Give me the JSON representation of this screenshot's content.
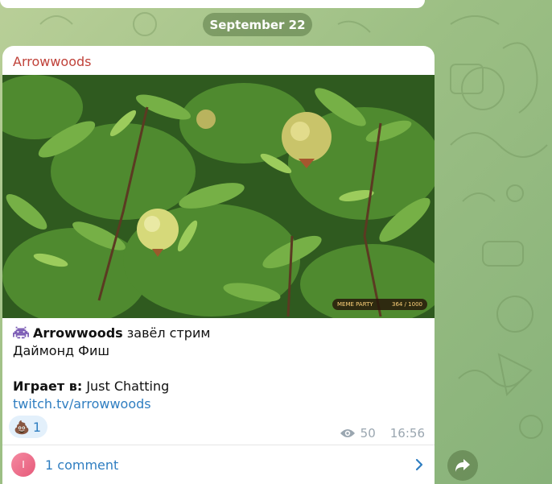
{
  "chat": {
    "date_separator": "September 22"
  },
  "message": {
    "sender": "Arrowwoods",
    "image": {
      "overlay_badge_title": "MEME PARTY",
      "overlay_badge_counter": "364 / 1000"
    },
    "text": {
      "streamer_name": "Arrowwoods",
      "action": "завёл стрим",
      "stream_title": "Даймонд Фиш",
      "playing_label": "Играет в:",
      "game": "Just Chatting",
      "link": "twitch.tv/arrowwoods"
    },
    "reaction": {
      "emoji": "💩",
      "count": "1"
    },
    "views": "50",
    "time": "16:56",
    "comments": {
      "avatar_letter": "I",
      "label": "1 comment"
    }
  },
  "colors": {
    "sender": "#c0423a",
    "link": "#2f7ec1",
    "reaction_bg": "#e3f0fb",
    "meta": "#9aa6b0"
  },
  "icons": {
    "views": "eye-icon",
    "comments_open": "chevron-right-icon",
    "share": "share-arrow-icon",
    "emoji_prefix": "space-invader-icon"
  }
}
